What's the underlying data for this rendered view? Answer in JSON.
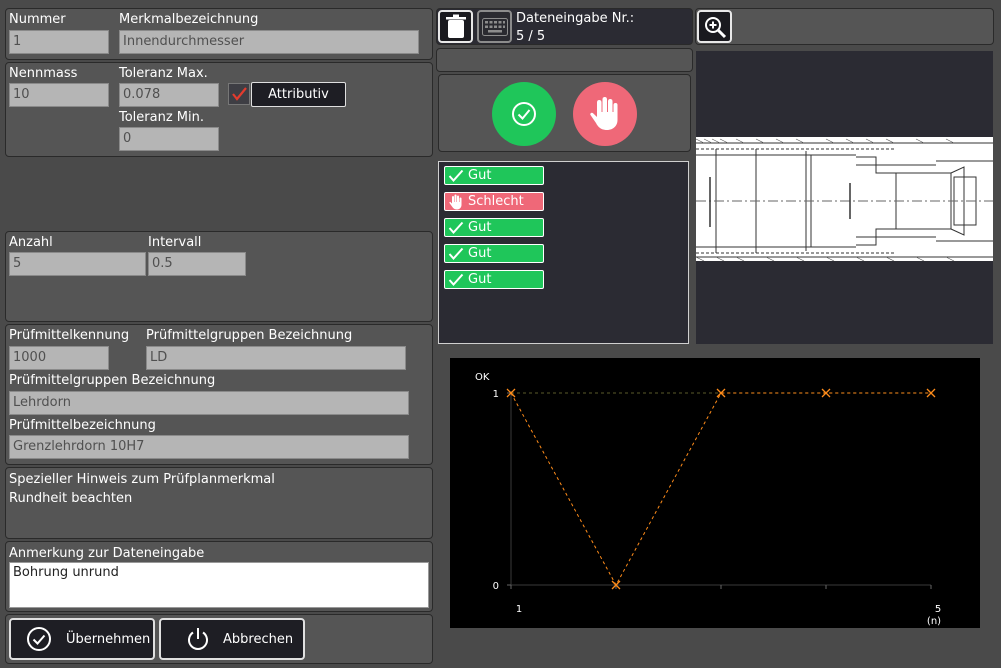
{
  "merkmal": {
    "nummer_label": "Nummer",
    "nummer_value": "1",
    "bezeichnung_label": "Merkmalbezeichnung",
    "bezeichnung_value": "Innendurchmesser"
  },
  "toleranz": {
    "nennmass_label": "Nennmass",
    "nennmass_value": "10",
    "max_label": "Toleranz Max.",
    "max_value": "0.078",
    "min_label": "Toleranz Min.",
    "min_value": "0",
    "attributiv_label": "Attributiv",
    "attributiv_checked": true
  },
  "stichprobe": {
    "anzahl_label": "Anzahl",
    "anzahl_value": "5",
    "intervall_label": "Intervall",
    "intervall_value": "0.5"
  },
  "pruefmittel": {
    "kennung_label": "Prüfmittelkennung",
    "kennung_value": "1000",
    "gruppe_label_1": "Prüfmittelgruppen Bezeichnung",
    "gruppe_value_1": "LD",
    "gruppe_label_2": "Prüfmittelgruppen Bezeichnung",
    "gruppe_value_2": "Lehrdorn",
    "bezeichnung_label": "Prüfmittelbezeichnung",
    "bezeichnung_value": "Grenzlehrdorn 10H7"
  },
  "hinweis": {
    "label": "Spezieller Hinweis zum Prüfplanmerkmal",
    "text": "Rundheit beachten"
  },
  "anmerkung": {
    "label": "Anmerkung zur Dateneingabe",
    "value": "Bohrung unrund"
  },
  "actions": {
    "uebernehmen": "Übernehmen",
    "abbrechen": "Abbrechen"
  },
  "dateneingabe": {
    "label": "Dateneingabe Nr.:",
    "counter": "5 / 5"
  },
  "results": [
    {
      "label": "Gut",
      "status": "gut"
    },
    {
      "label": "Schlecht",
      "status": "schlecht"
    },
    {
      "label": "Gut",
      "status": "gut"
    },
    {
      "label": "Gut",
      "status": "gut"
    },
    {
      "label": "Gut",
      "status": "gut"
    }
  ],
  "colors": {
    "gut": "#1fc65a",
    "schlecht": "#ef6878",
    "chart_line": "#ff8c1a"
  },
  "icons": [
    "trash-icon",
    "keyboard-icon",
    "zoom-in-icon",
    "check-circle-icon",
    "hand-stop-icon",
    "power-icon"
  ],
  "chart_data": {
    "type": "line",
    "x": [
      1,
      2,
      3,
      4,
      5
    ],
    "values": [
      1,
      0,
      1,
      1,
      1
    ],
    "ylabel": "OK",
    "xunit": "(n)",
    "xtick_labels": [
      "1",
      "5"
    ],
    "ytick_labels": [
      "0",
      "1"
    ],
    "xlim": [
      1,
      5
    ],
    "ylim": [
      0,
      1
    ],
    "line_style": "dashed",
    "marker": "x",
    "grid": false
  }
}
